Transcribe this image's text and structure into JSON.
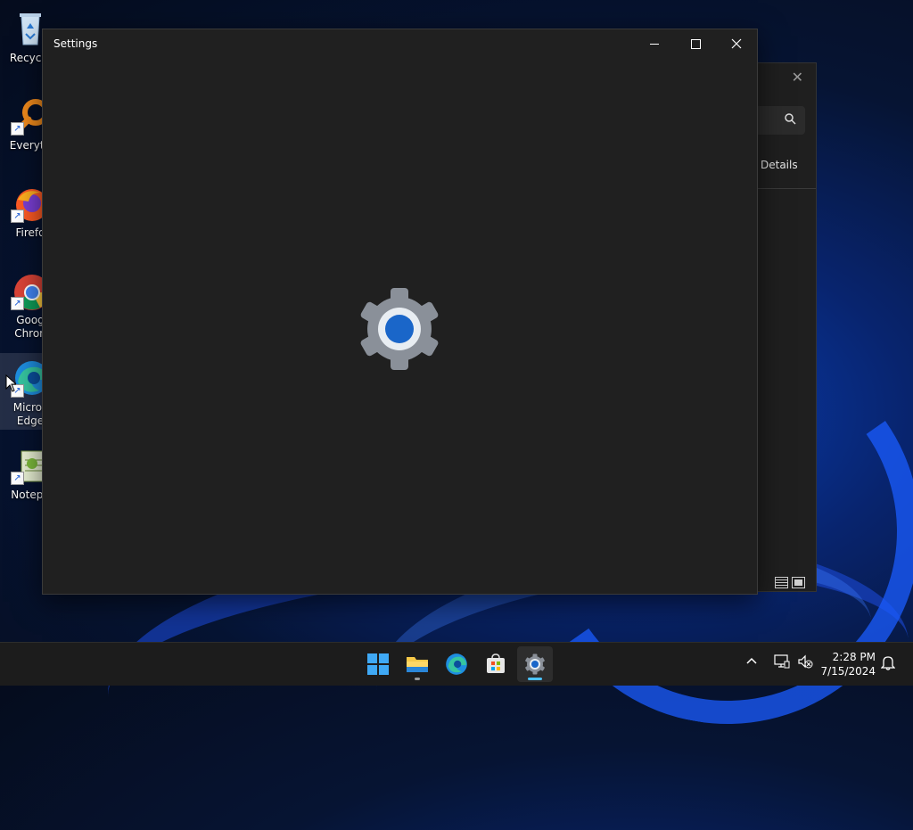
{
  "desktop": {
    "icons": [
      {
        "label": "Recycle",
        "icon": "recycle-bin-icon"
      },
      {
        "label": "Everyth",
        "icon": "everything-search-icon"
      },
      {
        "label": "Firefo",
        "icon": "firefox-icon"
      },
      {
        "label": "Goog\nChron",
        "icon": "chrome-icon"
      },
      {
        "label": "Micros\nEdge",
        "icon": "edge-icon"
      },
      {
        "label": "Notepa",
        "icon": "notepad-icon"
      }
    ]
  },
  "background_window": {
    "details_label": "Details",
    "search_icon": "search-icon",
    "close_glyph": "✕"
  },
  "settings_window": {
    "title": "Settings",
    "splash_icon": "settings-gear-icon"
  },
  "taskbar": {
    "apps": [
      {
        "name": "start",
        "icon": "windows-start-icon"
      },
      {
        "name": "file-explorer",
        "icon": "folder-icon"
      },
      {
        "name": "edge",
        "icon": "edge-icon"
      },
      {
        "name": "store",
        "icon": "store-icon"
      },
      {
        "name": "settings",
        "icon": "settings-gear-icon",
        "active": true
      }
    ],
    "tray": {
      "chevron": "^",
      "time": "2:28 PM",
      "date": "7/15/2024"
    }
  },
  "colors": {
    "accent": "#4cc2ff",
    "window_bg": "#202020",
    "taskbar_bg": "#1c1c1c",
    "gear_blue": "#1a66c9"
  }
}
